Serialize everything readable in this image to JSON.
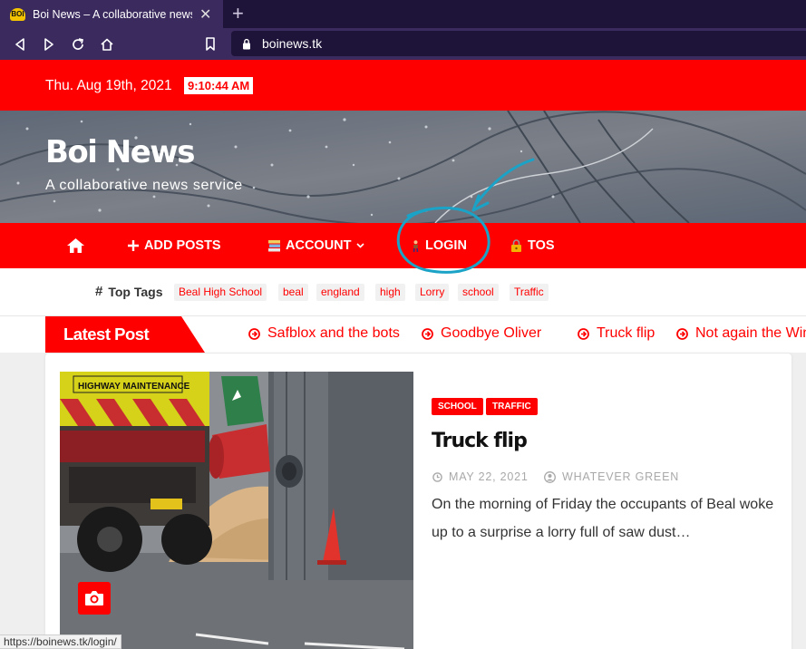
{
  "browser": {
    "tab_title": "Boi News – A collaborative news service",
    "favicon_text": "BOI",
    "new_tab_symbol": "+",
    "close_symbol": "✕",
    "url": "boinews.tk",
    "status_url": "https://boinews.tk/login/"
  },
  "topbar": {
    "date": "Thu. Aug 19th, 2021",
    "time": "9:10:44 AM"
  },
  "header": {
    "site_title": "Boi News",
    "tagline": "A collaborative news service"
  },
  "nav": {
    "items": [
      {
        "label": "",
        "icon": "home-icon"
      },
      {
        "label": "ADD POSTS",
        "icon": "plus-icon"
      },
      {
        "label": "ACCOUNT",
        "icon": "books-icon",
        "dropdown": true
      },
      {
        "label": "LOGIN",
        "icon": "person-icon"
      },
      {
        "label": "TOS",
        "icon": "lock-icon"
      }
    ]
  },
  "tags": {
    "label": "Top Tags",
    "items": [
      "Beal High School",
      "beal",
      "england",
      "high",
      "Lorry",
      "school",
      "Traffic"
    ]
  },
  "ticker": {
    "label": "Latest Post",
    "items": [
      "Safblox and the bots",
      "Goodbye Oliver",
      "Truck flip",
      "Not again the Wind"
    ]
  },
  "post": {
    "categories": [
      "SCHOOL",
      "TRAFFIC"
    ],
    "title": "Truck flip",
    "date": "MAY 22, 2021",
    "author": "WHATEVER GREEN",
    "excerpt": "On the morning of Friday the occupants of Beal woke up to a surprise a lorry full of saw dust…",
    "photo_sign_text": "HIGHWAY MAINTENANCE"
  },
  "colors": {
    "brand_red": "#ff0000",
    "browser_dark": "#1e1338",
    "browser_bar": "#3b2a5e",
    "annotation": "#1aa3c7"
  }
}
